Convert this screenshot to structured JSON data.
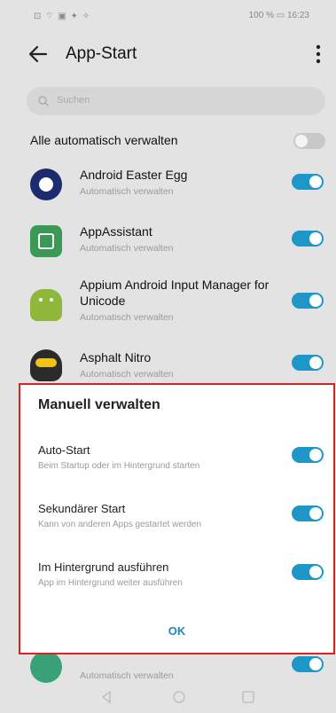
{
  "status": {
    "left_icons": "⊡ ⌔ ▣ ✦ ✧",
    "right_text": "100 % ▭ 16:23"
  },
  "header": {
    "title": "App-Start"
  },
  "search": {
    "placeholder": "Suchen"
  },
  "all_auto": {
    "label": "Alle automatisch verwalten",
    "enabled": false
  },
  "apps": [
    {
      "name": "Android Easter Egg",
      "subtitle": "Automatisch verwalten",
      "icon": "android-easter-egg-icon",
      "enabled": true
    },
    {
      "name": "AppAssistant",
      "subtitle": "Automatisch verwalten",
      "icon": "app-assistant-icon",
      "enabled": true
    },
    {
      "name": "Appium Android Input Manager for Unicode",
      "subtitle": "Automatisch verwalten",
      "icon": "appium-icon",
      "enabled": true
    },
    {
      "name": "Asphalt Nitro",
      "subtitle": "Automatisch verwalten",
      "icon": "asphalt-nitro-icon",
      "enabled": true
    },
    {
      "subtitle": "Automatisch verwalten",
      "icon": "android-app-icon",
      "enabled": true
    }
  ],
  "dialog": {
    "title": "Manuell verwalten",
    "options": [
      {
        "name": "Auto-Start",
        "description": "Beim Startup oder im Hintergrund starten",
        "enabled": true
      },
      {
        "name": "Sekundärer Start",
        "description": "Kann von anderen Apps gestartet werden",
        "enabled": true
      },
      {
        "name": "Im Hintergrund ausführen",
        "description": "App im Hintergrund weiter ausführen",
        "enabled": true
      }
    ],
    "ok_label": "OK"
  },
  "colors": {
    "accent": "#1e96c8",
    "highlight_border": "#e02020"
  }
}
